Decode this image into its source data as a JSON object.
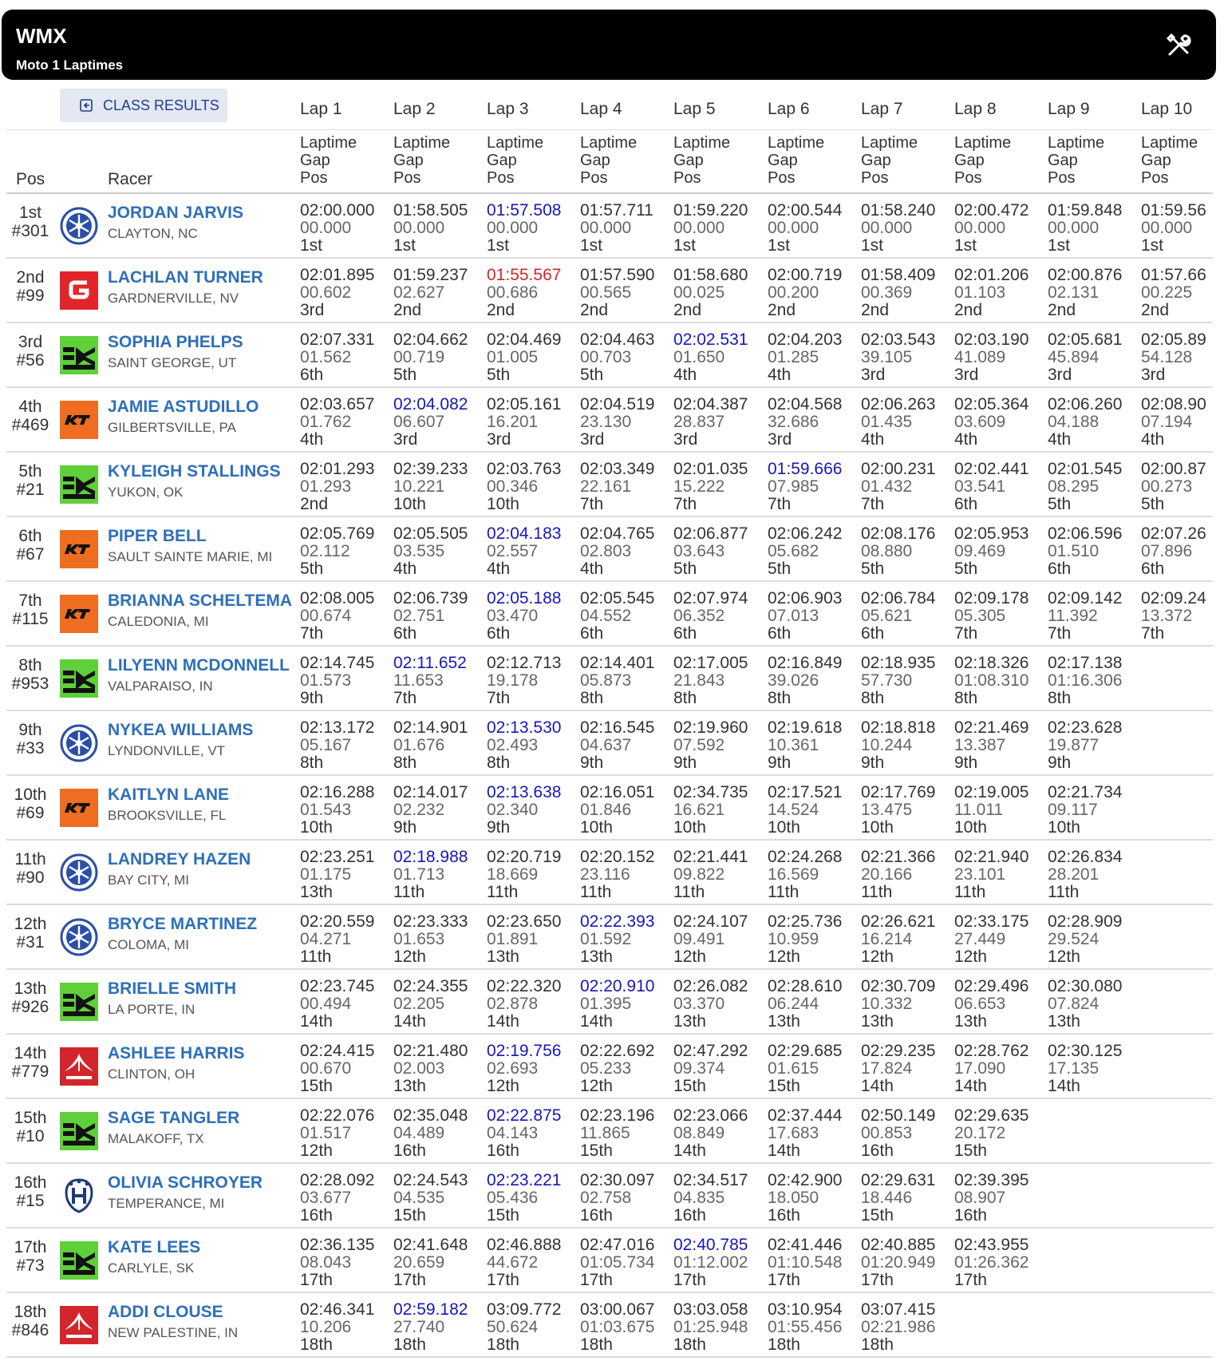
{
  "header": {
    "title": "WMX",
    "subtitle": "Moto 1 Laptimes"
  },
  "class_results_label": "CLASS RESULTS",
  "laps": [
    "Lap 1",
    "Lap 2",
    "Lap 3",
    "Lap 4",
    "Lap 5",
    "Lap 6",
    "Lap 7",
    "Lap 8",
    "Lap 9",
    "Lap 10"
  ],
  "col_sub": {
    "laptime": "Laptime",
    "gap": "Gap",
    "pos": "Pos"
  },
  "col_pos": "Pos",
  "col_racer": "Racer",
  "icons": {
    "tools": "tools-icon",
    "class_results": "back-icon"
  },
  "brand_colors": {
    "yamaha": "#2a4fa8",
    "gasgas": "#e0262a",
    "kawasaki": "#5fcf3a",
    "ktm": "#ef6d21",
    "husqvarna": "#1e3a7a",
    "honda": "#d3262c"
  },
  "rows": [
    {
      "place": "1st",
      "num": "#301",
      "name": "JORDAN JARVIS",
      "loc": "CLAYTON, NC",
      "brand": "yamaha",
      "laps": [
        [
          "02:00.000",
          "00.000",
          "1st",
          ""
        ],
        [
          "01:58.505",
          "00.000",
          "1st",
          ""
        ],
        [
          "01:57.508",
          "00.000",
          "1st",
          "best"
        ],
        [
          "01:57.711",
          "00.000",
          "1st",
          ""
        ],
        [
          "01:59.220",
          "00.000",
          "1st",
          ""
        ],
        [
          "02:00.544",
          "00.000",
          "1st",
          ""
        ],
        [
          "01:58.240",
          "00.000",
          "1st",
          ""
        ],
        [
          "02:00.472",
          "00.000",
          "1st",
          ""
        ],
        [
          "01:59.848",
          "00.000",
          "1st",
          ""
        ],
        [
          "01:59.56",
          "00.000",
          "1st",
          ""
        ]
      ]
    },
    {
      "place": "2nd",
      "num": "#99",
      "name": "LACHLAN TURNER",
      "loc": "GARDNERVILLE, NV",
      "brand": "gasgas",
      "laps": [
        [
          "02:01.895",
          "00.602",
          "3rd",
          ""
        ],
        [
          "01:59.237",
          "02.627",
          "2nd",
          ""
        ],
        [
          "01:55.567",
          "00.686",
          "2nd",
          "fast"
        ],
        [
          "01:57.590",
          "00.565",
          "2nd",
          ""
        ],
        [
          "01:58.680",
          "00.025",
          "2nd",
          ""
        ],
        [
          "02:00.719",
          "00.200",
          "2nd",
          ""
        ],
        [
          "01:58.409",
          "00.369",
          "2nd",
          ""
        ],
        [
          "02:01.206",
          "01.103",
          "2nd",
          ""
        ],
        [
          "02:00.876",
          "02.131",
          "2nd",
          ""
        ],
        [
          "01:57.66",
          "00.225",
          "2nd",
          ""
        ]
      ]
    },
    {
      "place": "3rd",
      "num": "#56",
      "name": "SOPHIA PHELPS",
      "loc": "SAINT GEORGE, UT",
      "brand": "kawasaki",
      "laps": [
        [
          "02:07.331",
          "01.562",
          "6th",
          ""
        ],
        [
          "02:04.662",
          "00.719",
          "5th",
          ""
        ],
        [
          "02:04.469",
          "01.005",
          "5th",
          ""
        ],
        [
          "02:04.463",
          "00.703",
          "5th",
          ""
        ],
        [
          "02:02.531",
          "01.650",
          "4th",
          "best"
        ],
        [
          "02:04.203",
          "01.285",
          "4th",
          ""
        ],
        [
          "02:03.543",
          "39.105",
          "3rd",
          ""
        ],
        [
          "02:03.190",
          "41.089",
          "3rd",
          ""
        ],
        [
          "02:05.681",
          "45.894",
          "3rd",
          ""
        ],
        [
          "02:05.89",
          "54.128",
          "3rd",
          ""
        ]
      ]
    },
    {
      "place": "4th",
      "num": "#469",
      "name": "JAMIE ASTUDILLO",
      "loc": "GILBERTSVILLE, PA",
      "brand": "ktm",
      "laps": [
        [
          "02:03.657",
          "01.762",
          "4th",
          ""
        ],
        [
          "02:04.082",
          "06.607",
          "3rd",
          "best"
        ],
        [
          "02:05.161",
          "16.201",
          "3rd",
          ""
        ],
        [
          "02:04.519",
          "23.130",
          "3rd",
          ""
        ],
        [
          "02:04.387",
          "28.837",
          "3rd",
          ""
        ],
        [
          "02:04.568",
          "32.686",
          "3rd",
          ""
        ],
        [
          "02:06.263",
          "01.435",
          "4th",
          ""
        ],
        [
          "02:05.364",
          "03.609",
          "4th",
          ""
        ],
        [
          "02:06.260",
          "04.188",
          "4th",
          ""
        ],
        [
          "02:08.90",
          "07.194",
          "4th",
          ""
        ]
      ]
    },
    {
      "place": "5th",
      "num": "#21",
      "name": "KYLEIGH STALLINGS",
      "loc": "YUKON, OK",
      "brand": "kawasaki",
      "laps": [
        [
          "02:01.293",
          "01.293",
          "2nd",
          ""
        ],
        [
          "02:39.233",
          "10.221",
          "10th",
          ""
        ],
        [
          "02:03.763",
          "00.346",
          "10th",
          ""
        ],
        [
          "02:03.349",
          "22.161",
          "7th",
          ""
        ],
        [
          "02:01.035",
          "15.222",
          "7th",
          ""
        ],
        [
          "01:59.666",
          "07.985",
          "7th",
          "best"
        ],
        [
          "02:00.231",
          "01.432",
          "7th",
          ""
        ],
        [
          "02:02.441",
          "03.541",
          "6th",
          ""
        ],
        [
          "02:01.545",
          "08.295",
          "5th",
          ""
        ],
        [
          "02:00.87",
          "00.273",
          "5th",
          ""
        ]
      ]
    },
    {
      "place": "6th",
      "num": "#67",
      "name": "PIPER BELL",
      "loc": "SAULT SAINTE MARIE, MI",
      "brand": "ktm",
      "laps": [
        [
          "02:05.769",
          "02.112",
          "5th",
          ""
        ],
        [
          "02:05.505",
          "03.535",
          "4th",
          ""
        ],
        [
          "02:04.183",
          "02.557",
          "4th",
          "best"
        ],
        [
          "02:04.765",
          "02.803",
          "4th",
          ""
        ],
        [
          "02:06.877",
          "03.643",
          "5th",
          ""
        ],
        [
          "02:06.242",
          "05.682",
          "5th",
          ""
        ],
        [
          "02:08.176",
          "08.880",
          "5th",
          ""
        ],
        [
          "02:05.953",
          "09.469",
          "5th",
          ""
        ],
        [
          "02:06.596",
          "01.510",
          "6th",
          ""
        ],
        [
          "02:07.26",
          "07.896",
          "6th",
          ""
        ]
      ]
    },
    {
      "place": "7th",
      "num": "#115",
      "name": "BRIANNA SCHELTEMA",
      "loc": "CALEDONIA, MI",
      "brand": "ktm",
      "laps": [
        [
          "02:08.005",
          "00.674",
          "7th",
          ""
        ],
        [
          "02:06.739",
          "02.751",
          "6th",
          ""
        ],
        [
          "02:05.188",
          "03.470",
          "6th",
          "best"
        ],
        [
          "02:05.545",
          "04.552",
          "6th",
          ""
        ],
        [
          "02:07.974",
          "06.352",
          "6th",
          ""
        ],
        [
          "02:06.903",
          "07.013",
          "6th",
          ""
        ],
        [
          "02:06.784",
          "05.621",
          "6th",
          ""
        ],
        [
          "02:09.178",
          "05.305",
          "7th",
          ""
        ],
        [
          "02:09.142",
          "11.392",
          "7th",
          ""
        ],
        [
          "02:09.24",
          "13.372",
          "7th",
          ""
        ]
      ]
    },
    {
      "place": "8th",
      "num": "#953",
      "name": "LILYENN MCDONNELL",
      "loc": "VALPARAISO, IN",
      "brand": "kawasaki",
      "laps": [
        [
          "02:14.745",
          "01.573",
          "9th",
          ""
        ],
        [
          "02:11.652",
          "11.653",
          "7th",
          "best"
        ],
        [
          "02:12.713",
          "19.178",
          "7th",
          ""
        ],
        [
          "02:14.401",
          "05.873",
          "8th",
          ""
        ],
        [
          "02:17.005",
          "21.843",
          "8th",
          ""
        ],
        [
          "02:16.849",
          "39.026",
          "8th",
          ""
        ],
        [
          "02:18.935",
          "57.730",
          "8th",
          ""
        ],
        [
          "02:18.326",
          "01:08.310",
          "8th",
          ""
        ],
        [
          "02:17.138",
          "01:16.306",
          "8th",
          ""
        ]
      ]
    },
    {
      "place": "9th",
      "num": "#33",
      "name": "NYKEA WILLIAMS",
      "loc": "LYNDONVILLE, VT",
      "brand": "yamaha",
      "laps": [
        [
          "02:13.172",
          "05.167",
          "8th",
          ""
        ],
        [
          "02:14.901",
          "01.676",
          "8th",
          ""
        ],
        [
          "02:13.530",
          "02.493",
          "8th",
          "best"
        ],
        [
          "02:16.545",
          "04.637",
          "9th",
          ""
        ],
        [
          "02:19.960",
          "07.592",
          "9th",
          ""
        ],
        [
          "02:19.618",
          "10.361",
          "9th",
          ""
        ],
        [
          "02:18.818",
          "10.244",
          "9th",
          ""
        ],
        [
          "02:21.469",
          "13.387",
          "9th",
          ""
        ],
        [
          "02:23.628",
          "19.877",
          "9th",
          ""
        ]
      ]
    },
    {
      "place": "10th",
      "num": "#69",
      "name": "KAITLYN LANE",
      "loc": "BROOKSVILLE, FL",
      "brand": "ktm",
      "laps": [
        [
          "02:16.288",
          "01.543",
          "10th",
          ""
        ],
        [
          "02:14.017",
          "02.232",
          "9th",
          ""
        ],
        [
          "02:13.638",
          "02.340",
          "9th",
          "best"
        ],
        [
          "02:16.051",
          "01.846",
          "10th",
          ""
        ],
        [
          "02:34.735",
          "16.621",
          "10th",
          ""
        ],
        [
          "02:17.521",
          "14.524",
          "10th",
          ""
        ],
        [
          "02:17.769",
          "13.475",
          "10th",
          ""
        ],
        [
          "02:19.005",
          "11.011",
          "10th",
          ""
        ],
        [
          "02:21.734",
          "09.117",
          "10th",
          ""
        ]
      ]
    },
    {
      "place": "11th",
      "num": "#90",
      "name": "LANDREY HAZEN",
      "loc": "BAY CITY, MI",
      "brand": "yamaha",
      "laps": [
        [
          "02:23.251",
          "01.175",
          "13th",
          ""
        ],
        [
          "02:18.988",
          "01.713",
          "11th",
          "best"
        ],
        [
          "02:20.719",
          "18.669",
          "11th",
          ""
        ],
        [
          "02:20.152",
          "23.116",
          "11th",
          ""
        ],
        [
          "02:21.441",
          "09.822",
          "11th",
          ""
        ],
        [
          "02:24.268",
          "16.569",
          "11th",
          ""
        ],
        [
          "02:21.366",
          "20.166",
          "11th",
          ""
        ],
        [
          "02:21.940",
          "23.101",
          "11th",
          ""
        ],
        [
          "02:26.834",
          "28.201",
          "11th",
          ""
        ]
      ]
    },
    {
      "place": "12th",
      "num": "#31",
      "name": "BRYCE MARTINEZ",
      "loc": "COLOMA, MI",
      "brand": "yamaha",
      "laps": [
        [
          "02:20.559",
          "04.271",
          "11th",
          ""
        ],
        [
          "02:23.333",
          "01.653",
          "12th",
          ""
        ],
        [
          "02:23.650",
          "01.891",
          "13th",
          ""
        ],
        [
          "02:22.393",
          "01.592",
          "13th",
          "best"
        ],
        [
          "02:24.107",
          "09.491",
          "12th",
          ""
        ],
        [
          "02:25.736",
          "10.959",
          "12th",
          ""
        ],
        [
          "02:26.621",
          "16.214",
          "12th",
          ""
        ],
        [
          "02:33.175",
          "27.449",
          "12th",
          ""
        ],
        [
          "02:28.909",
          "29.524",
          "12th",
          ""
        ]
      ]
    },
    {
      "place": "13th",
      "num": "#926",
      "name": "BRIELLE SMITH",
      "loc": "LA PORTE, IN",
      "brand": "kawasaki",
      "laps": [
        [
          "02:23.745",
          "00.494",
          "14th",
          ""
        ],
        [
          "02:24.355",
          "02.205",
          "14th",
          ""
        ],
        [
          "02:22.320",
          "02.878",
          "14th",
          ""
        ],
        [
          "02:20.910",
          "01.395",
          "14th",
          "best"
        ],
        [
          "02:26.082",
          "03.370",
          "13th",
          ""
        ],
        [
          "02:28.610",
          "06.244",
          "13th",
          ""
        ],
        [
          "02:30.709",
          "10.332",
          "13th",
          ""
        ],
        [
          "02:29.496",
          "06.653",
          "13th",
          ""
        ],
        [
          "02:30.080",
          "07.824",
          "13th",
          ""
        ]
      ]
    },
    {
      "place": "14th",
      "num": "#779",
      "name": "ASHLEE HARRIS",
      "loc": "CLINTON, OH",
      "brand": "honda",
      "laps": [
        [
          "02:24.415",
          "00.670",
          "15th",
          ""
        ],
        [
          "02:21.480",
          "02.003",
          "13th",
          ""
        ],
        [
          "02:19.756",
          "02.693",
          "12th",
          "best"
        ],
        [
          "02:22.692",
          "05.233",
          "12th",
          ""
        ],
        [
          "02:47.292",
          "09.374",
          "15th",
          ""
        ],
        [
          "02:29.685",
          "01.615",
          "15th",
          ""
        ],
        [
          "02:29.235",
          "17.824",
          "14th",
          ""
        ],
        [
          "02:28.762",
          "17.090",
          "14th",
          ""
        ],
        [
          "02:30.125",
          "17.135",
          "14th",
          ""
        ]
      ]
    },
    {
      "place": "15th",
      "num": "#10",
      "name": "SAGE TANGLER",
      "loc": "MALAKOFF, TX",
      "brand": "kawasaki",
      "laps": [
        [
          "02:22.076",
          "01.517",
          "12th",
          ""
        ],
        [
          "02:35.048",
          "04.489",
          "16th",
          ""
        ],
        [
          "02:22.875",
          "04.143",
          "16th",
          "best"
        ],
        [
          "02:23.196",
          "11.865",
          "15th",
          ""
        ],
        [
          "02:23.066",
          "08.849",
          "14th",
          ""
        ],
        [
          "02:37.444",
          "17.683",
          "14th",
          ""
        ],
        [
          "02:50.149",
          "00.853",
          "16th",
          ""
        ],
        [
          "02:29.635",
          "20.172",
          "15th",
          ""
        ]
      ]
    },
    {
      "place": "16th",
      "num": "#15",
      "name": "OLIVIA SCHROYER",
      "loc": "TEMPERANCE, MI",
      "brand": "husqvarna",
      "laps": [
        [
          "02:28.092",
          "03.677",
          "16th",
          ""
        ],
        [
          "02:24.543",
          "04.535",
          "15th",
          ""
        ],
        [
          "02:23.221",
          "05.436",
          "15th",
          "best"
        ],
        [
          "02:30.097",
          "02.758",
          "16th",
          ""
        ],
        [
          "02:34.517",
          "04.835",
          "16th",
          ""
        ],
        [
          "02:42.900",
          "18.050",
          "16th",
          ""
        ],
        [
          "02:29.631",
          "18.446",
          "15th",
          ""
        ],
        [
          "02:39.395",
          "08.907",
          "16th",
          ""
        ]
      ]
    },
    {
      "place": "17th",
      "num": "#73",
      "name": "KATE LEES",
      "loc": "CARLYLE, SK",
      "brand": "kawasaki",
      "laps": [
        [
          "02:36.135",
          "08.043",
          "17th",
          ""
        ],
        [
          "02:41.648",
          "20.659",
          "17th",
          ""
        ],
        [
          "02:46.888",
          "44.672",
          "17th",
          ""
        ],
        [
          "02:47.016",
          "01:05.734",
          "17th",
          ""
        ],
        [
          "02:40.785",
          "01:12.002",
          "17th",
          "best"
        ],
        [
          "02:41.446",
          "01:10.548",
          "17th",
          ""
        ],
        [
          "02:40.885",
          "01:20.949",
          "17th",
          ""
        ],
        [
          "02:43.955",
          "01:26.362",
          "17th",
          ""
        ]
      ]
    },
    {
      "place": "18th",
      "num": "#846",
      "name": "ADDI CLOUSE",
      "loc": "NEW PALESTINE, IN",
      "brand": "honda",
      "laps": [
        [
          "02:46.341",
          "10.206",
          "18th",
          ""
        ],
        [
          "02:59.182",
          "27.740",
          "18th",
          "best"
        ],
        [
          "03:09.772",
          "50.624",
          "18th",
          ""
        ],
        [
          "03:00.067",
          "01:03.675",
          "18th",
          ""
        ],
        [
          "03:03.058",
          "01:25.948",
          "18th",
          ""
        ],
        [
          "03:10.954",
          "01:55.456",
          "18th",
          ""
        ],
        [
          "03:07.415",
          "02:21.986",
          "18th",
          ""
        ]
      ]
    }
  ]
}
